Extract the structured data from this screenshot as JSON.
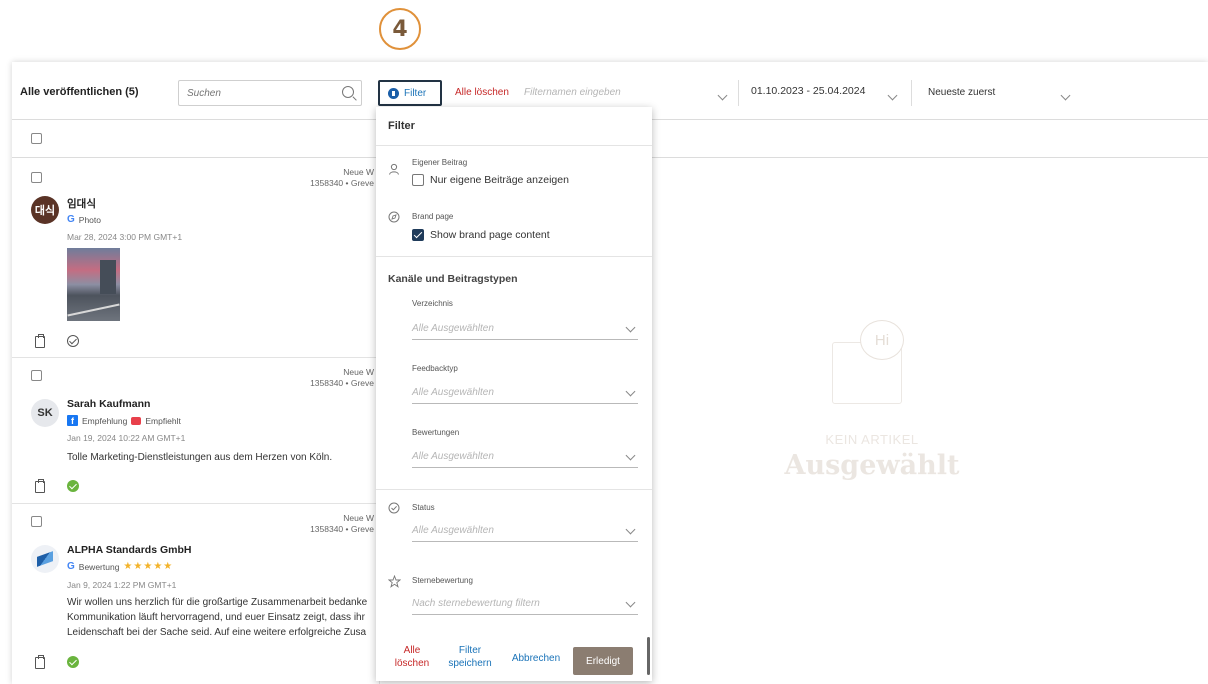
{
  "step_number": "4",
  "toolbar": {
    "title": "Alle veröffentlichen (5)",
    "search_placeholder": "Suchen",
    "filter_label": "Filter",
    "clear_all": "Alle löschen",
    "filtername_placeholder": "Filternamen eingeben",
    "date_range": "01.10.2023 - 25.04.2024",
    "sort": "Neueste zuerst"
  },
  "posts": [
    {
      "status_label": "Neue W",
      "location_id": "1358340 • Greve",
      "avatar_text": "대식",
      "avatar_color": "#5a3326",
      "author": "임대식",
      "source": "Photo",
      "date": "Mar 28, 2024 3:00 PM GMT+1"
    },
    {
      "status_label": "Neue W",
      "location_id": "1358340 • Greve",
      "avatar_text": "SK",
      "avatar_color": "#e6e8ec",
      "author": "Sarah Kaufmann",
      "source": "Empfehlung",
      "source_extra": "Empfiehlt",
      "date": "Jan 19, 2024 10:22 AM GMT+1",
      "text": "Tolle Marketing-Dienstleistungen aus dem Herzen von Köln."
    },
    {
      "status_label": "Neue W",
      "location_id": "1358340 • Greve",
      "author": "ALPHA Standards GmbH",
      "source": "Bewertung",
      "rating_stars": "★★★★★",
      "rating": 5,
      "date": "Jan 9, 2024 1:22 PM GMT+1",
      "text_lines": [
        "Wir wollen uns herzlich für die großartige Zusammenarbeit bedanke",
        "Kommunikation läuft hervorragend, und euer Einsatz zeigt, dass ihr",
        "Leidenschaft bei der Sache seid. Auf eine weitere erfolgreiche Zusa"
      ]
    }
  ],
  "empty_state": {
    "bubble_text": "Hi",
    "subtitle": "KEIN ARTIKEL",
    "title": "Ausgewählt"
  },
  "filter_panel": {
    "title": "Filter",
    "own_post": {
      "label": "Eigener Beitrag",
      "option": "Nur eigene Beiträge anzeigen",
      "checked": false
    },
    "brand_page": {
      "label": "Brand page",
      "option": "Show brand page content",
      "checked": true
    },
    "section_title": "Kanäle und Beitragstypen",
    "directory": {
      "label": "Verzeichnis",
      "value": "Alle Ausgewählten"
    },
    "feedback_type": {
      "label": "Feedbacktyp",
      "value": "Alle Ausgewählten"
    },
    "ratings": {
      "label": "Bewertungen",
      "value": "Alle Ausgewählten"
    },
    "status": {
      "label": "Status",
      "value": "Alle Ausgewählten"
    },
    "star_rating": {
      "label": "Sternebewertung",
      "placeholder": "Nach sternebewertung filtern"
    },
    "footer": {
      "clear_line1": "Alle",
      "clear_line2": "löschen",
      "save_line1": "Filter",
      "save_line2": "speichern",
      "cancel": "Abbrechen",
      "done": "Erledigt"
    }
  },
  "colors": {
    "accent_blue": "#1a73b8",
    "danger_red": "#c62828",
    "done_button": "#8b7d71",
    "success_green": "#6ab43e",
    "star_yellow": "#f3b32a",
    "step_badge_orange": "#e0913a"
  }
}
